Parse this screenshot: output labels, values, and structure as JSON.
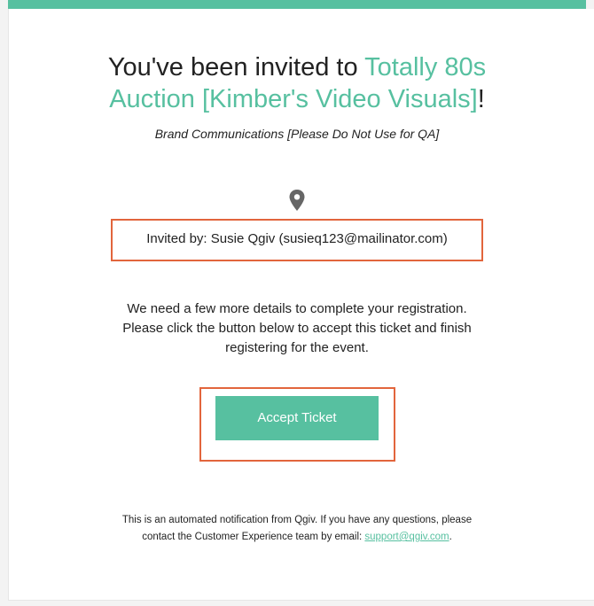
{
  "email": {
    "heading_prefix": "You've been invited to ",
    "heading_line2": "Auction [Kimber's Video Visuals]",
    "heading_event_line1": "Totally 80s",
    "heading_suffix": "!",
    "organization": "Brand Communications [Please Do Not Use for QA]",
    "location_icon": "map-pin-icon",
    "invited_by": "Invited by: Susie Qgiv (susieq123@mailinator.com)",
    "details_lines": [
      "We need a few more details to complete your registration.",
      "Please click the button below to accept this ticket and finish",
      "registering for the event."
    ],
    "accept_label": "Accept Ticket",
    "footer_line1": "This is an automated notification from Qgiv. If you have any questions, please",
    "footer_line2_prefix": "contact the Customer Experience team by email: ",
    "footer_email": "support@qgiv.com",
    "footer_line2_suffix": "."
  },
  "colors": {
    "accent": "#57c0a0",
    "highlight_outline": "#e2653c",
    "text": "#222222",
    "background": "#f3f3f3",
    "card": "#ffffff",
    "pin": "#666666"
  }
}
